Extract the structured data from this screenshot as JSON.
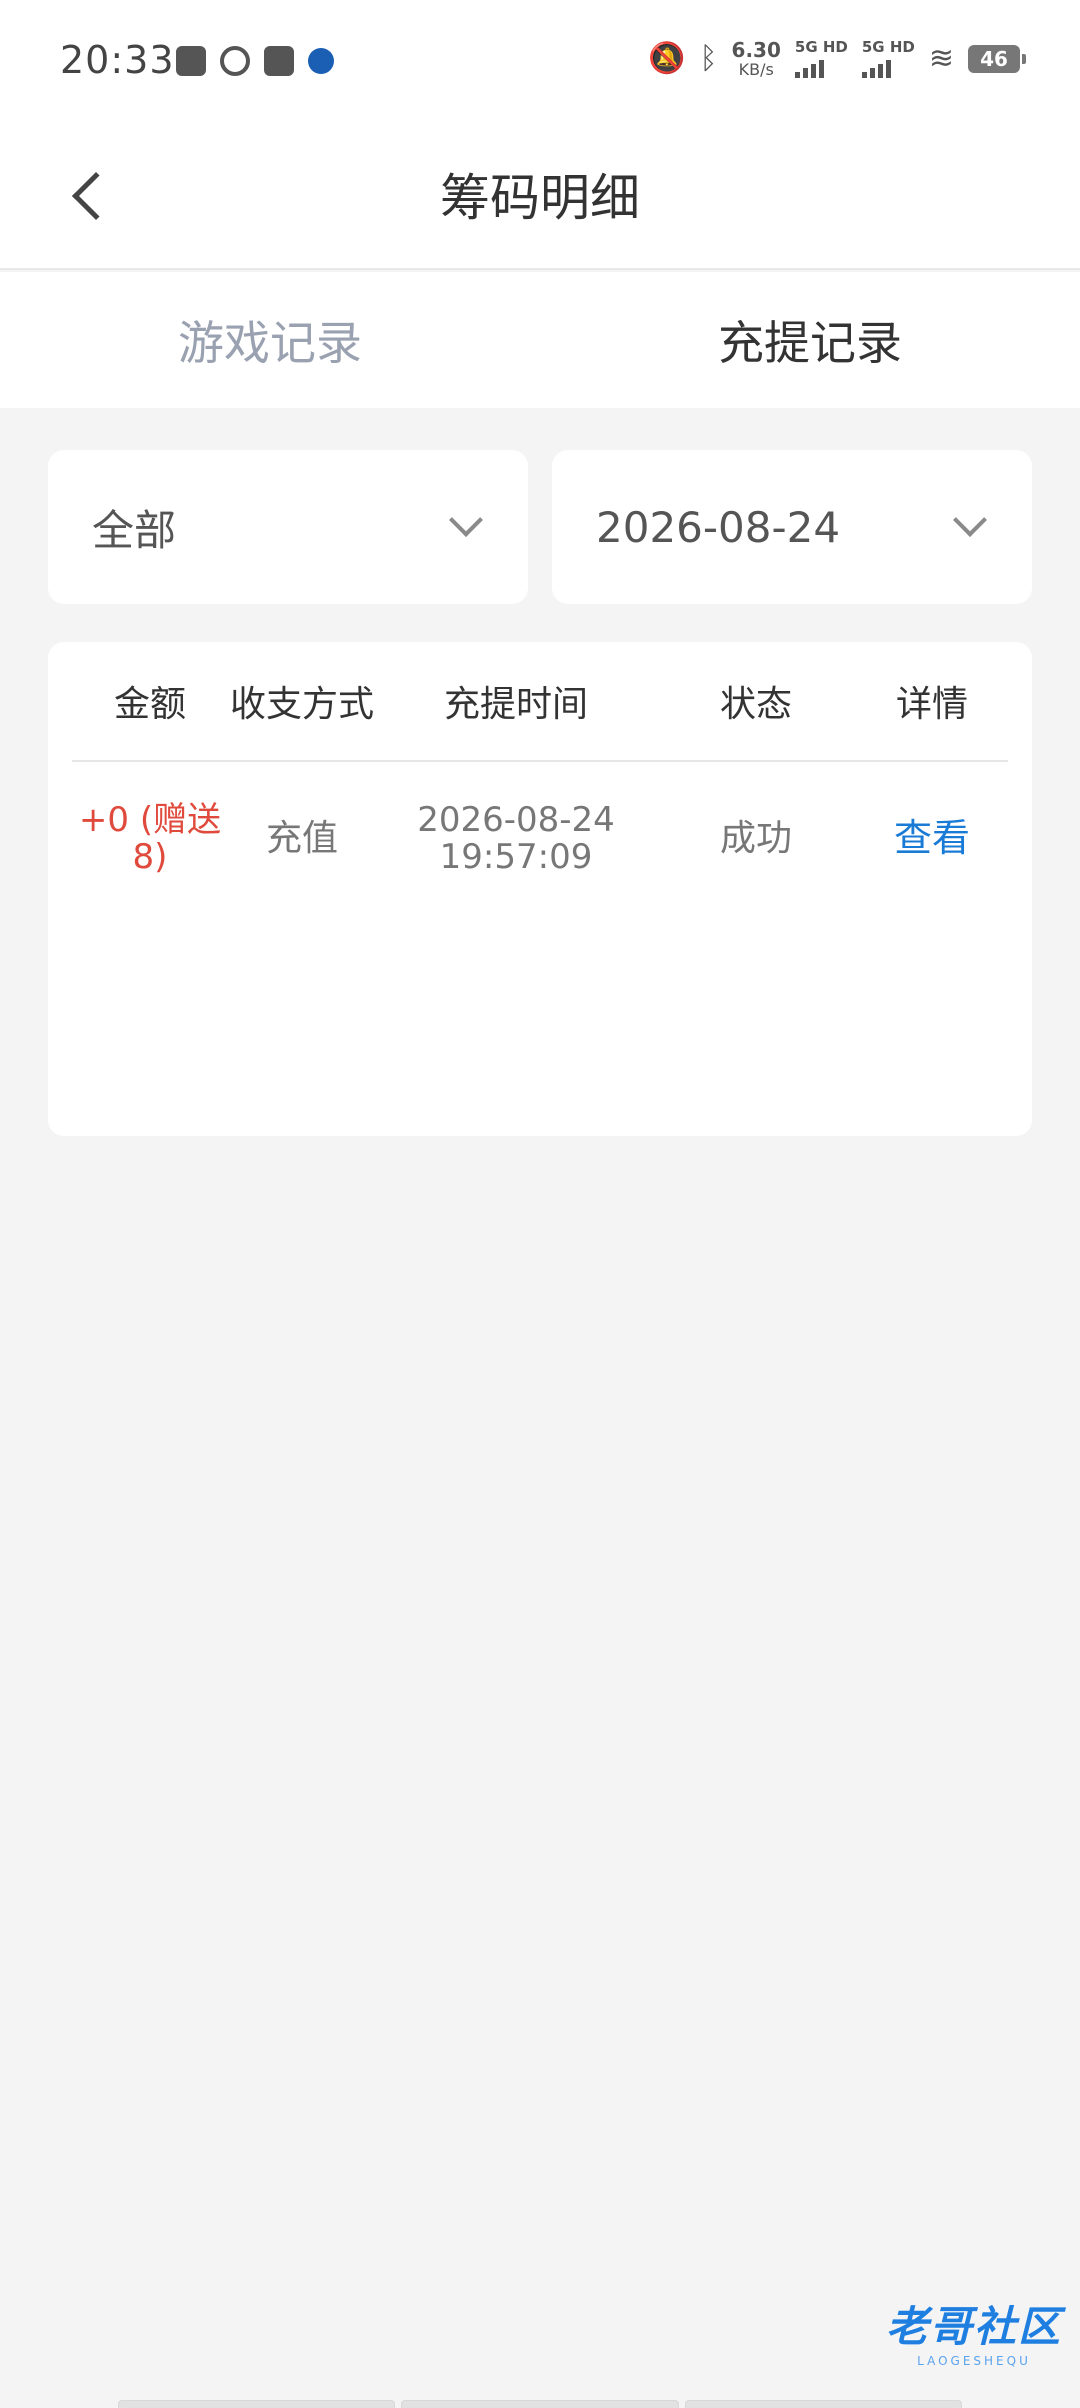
{
  "status_bar": {
    "time": "20:33",
    "net_speed": "6.30",
    "net_unit": "KB/s",
    "signal1_label": "5G HD",
    "signal2_label": "5G HD",
    "battery": "46",
    "icons": [
      "mute-bell-icon",
      "bluetooth-icon",
      "wifi-icon"
    ]
  },
  "header": {
    "title": "筹码明细"
  },
  "tabs": [
    {
      "label": "游戏记录",
      "active": false
    },
    {
      "label": "充提记录",
      "active": true
    }
  ],
  "filters": {
    "type": "全部",
    "date": "2026-08-24"
  },
  "table": {
    "columns": [
      "金额",
      "收支方式",
      "充提时间",
      "状态",
      "详情"
    ],
    "rows": [
      {
        "amount_line1": "+0 (赠送",
        "amount_line2": "8)",
        "method": "充值",
        "date": "2026-08-24",
        "time": "19:57:09",
        "status": "成功",
        "detail": "查看"
      }
    ]
  },
  "watermark": {
    "logo": "老哥社区",
    "subtitle": "LAOGESHEQU"
  },
  "colors": {
    "accent_link": "#1a7bd6",
    "amount_red": "#e04a3c",
    "tab_inactive": "#9aa1b0",
    "background": "#f4f4f4"
  }
}
